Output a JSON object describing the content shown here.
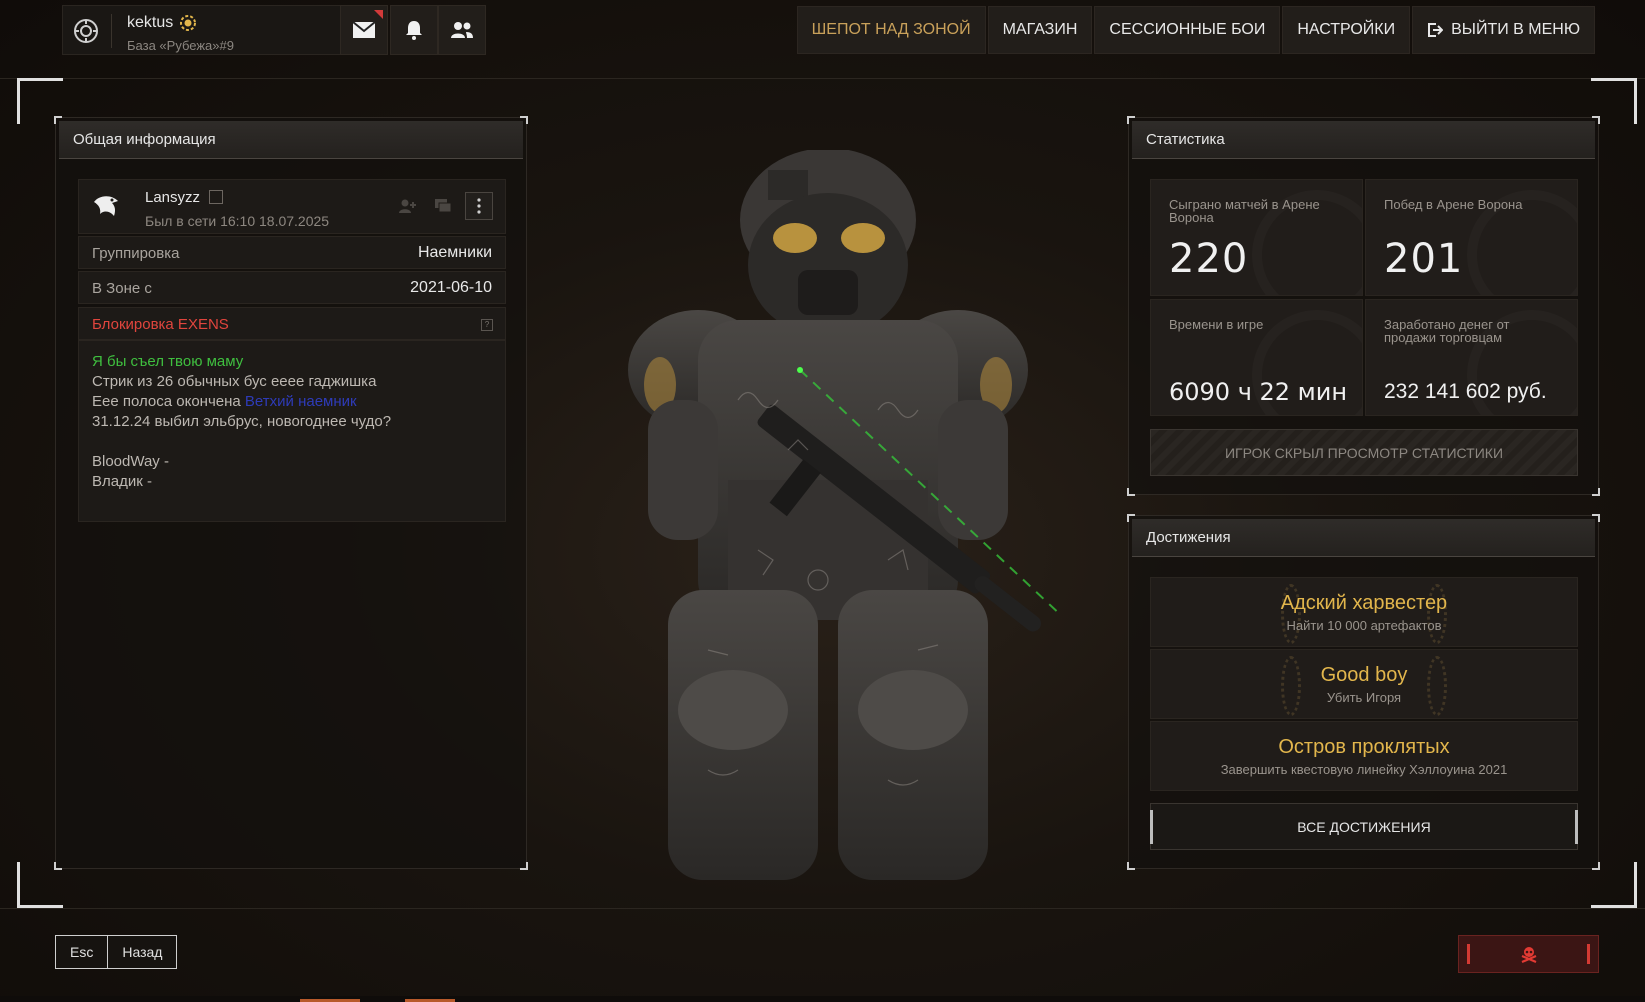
{
  "topbar": {
    "player_name": "kektus",
    "player_base": "База «Рубежа»#9",
    "nav": [
      "ШЕПОТ НАД ЗОНОЙ",
      "МАГАЗИН",
      "СЕССИОННЫЕ БОИ",
      "НАСТРОЙКИ",
      "ВЫЙТИ В МЕНЮ"
    ],
    "active_nav": "ШЕПОТ НАД ЗОНОЙ"
  },
  "general": {
    "title": "Общая информация",
    "user_name": "Lansyzz",
    "last_seen": "Был в сети 16:10 18.07.2025",
    "faction_label": "Группировка",
    "faction_value": "Наемники",
    "since_label": "В Зоне с",
    "since_value": "2021-06-10",
    "ban_label": "Блокировка EXENS",
    "ban_icon": "?",
    "status": {
      "line1": "Я бы съел твою маму",
      "line2": "Стрик из 26 обычных бус ееее гаджишка",
      "line3_prefix": "Еее полоса окончена ",
      "line3_link": "Ветхий наемник",
      "line4": "31.12.24 выбил эльбрус, новогоднее чудо?",
      "line5": "BloodWay -",
      "line6": "Владик -"
    }
  },
  "stats": {
    "title": "Статистика",
    "matches_label": "Сыграно матчей в Арене Ворона",
    "matches_value": "220",
    "wins_label": "Побед в Арене Ворона",
    "wins_value": "201",
    "time_label": "Времени в игре",
    "time_value": "6090 ч 22 мин",
    "money_label": "Заработано денег от продажи торговцам",
    "money_value": "232 141 602 руб.",
    "hidden_notice": "ИГРОК СКРЫЛ ПРОСМОТР СТАТИСТИКИ"
  },
  "achievements": {
    "title": "Достижения",
    "items": [
      {
        "title": "Адский харвестер",
        "desc": "Найти 10 000 артефактов"
      },
      {
        "title": "Good boy",
        "desc": "Убить Игоря"
      },
      {
        "title": "Остров проклятых",
        "desc": "Завершить квестовую линейку Хэллоуина 2021"
      }
    ],
    "all_button": "ВСЕ ДОСТИЖЕНИЯ"
  },
  "bottom": {
    "esc": "Esc",
    "back": "Назад"
  },
  "colors": {
    "accent_gold": "#e2b64c",
    "nav_active": "#c9a15a",
    "ban_red": "#e0453d",
    "status_green": "#3fbf3f"
  }
}
